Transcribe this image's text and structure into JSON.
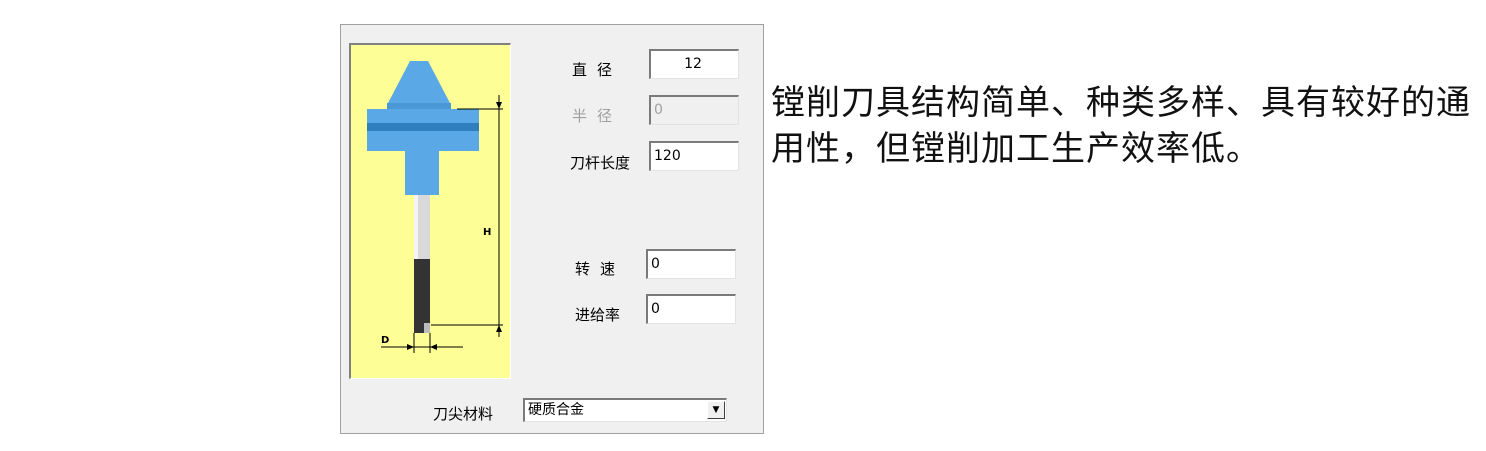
{
  "dialog": {
    "diameter_label": "直径",
    "diameter_value": "12",
    "radius_label": "半径",
    "radius_value": "0",
    "shank_length_label": "刀杆长度",
    "shank_length_value": "120",
    "spindle_speed_label": "转速",
    "spindle_speed_value": "0",
    "feed_rate_label": "进给率",
    "feed_rate_value": "0",
    "tip_material_label": "刀尖材料",
    "tip_material_value": "硬质合金",
    "preview": {
      "height_dim_label": "H",
      "diameter_dim_label": "D",
      "background_color": "#fefe96",
      "holder_color": "#5aa9e6",
      "shank_color": "#d9d9d9",
      "tip_color": "#333333"
    }
  },
  "caption": "镗削刀具结构简单、种类多样、具有较好的通用性，但镗削加工生产效率低。"
}
